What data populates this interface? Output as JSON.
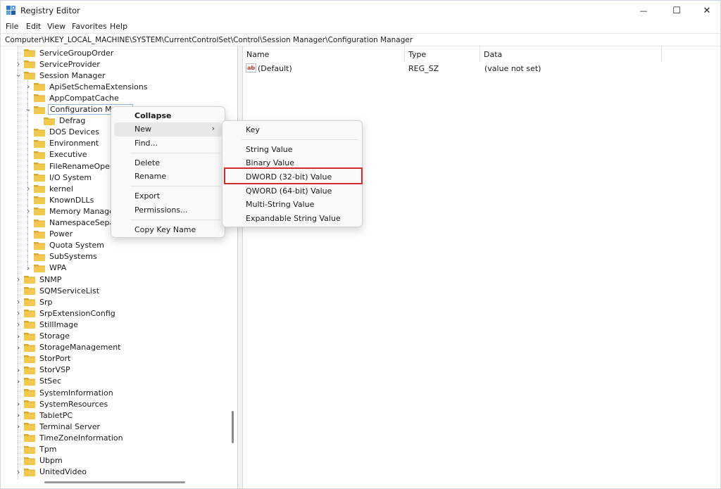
{
  "window": {
    "title": "Registry Editor",
    "controls": {
      "minimize": "—",
      "maximize": "☐",
      "close": "✕"
    }
  },
  "menubar": [
    "File",
    "Edit",
    "View",
    "Favorites",
    "Help"
  ],
  "address": "Computer\\HKEY_LOCAL_MACHINE\\SYSTEM\\CurrentControlSet\\Control\\Session Manager\\Configuration Manager",
  "tree": [
    {
      "label": "ServiceGroupOrder",
      "level": 0,
      "expander": "none"
    },
    {
      "label": "ServiceProvider",
      "level": 0,
      "expander": "collapsed"
    },
    {
      "label": "Session Manager",
      "level": 0,
      "expander": "expanded"
    },
    {
      "label": "ApiSetSchemaExtensions",
      "level": 1,
      "expander": "collapsed"
    },
    {
      "label": "AppCompatCache",
      "level": 1,
      "expander": "none"
    },
    {
      "label": "Configuration Manag",
      "level": 1,
      "expander": "expanded",
      "selected": true
    },
    {
      "label": "Defrag",
      "level": 2,
      "expander": "none"
    },
    {
      "label": "DOS Devices",
      "level": 1,
      "expander": "none"
    },
    {
      "label": "Environment",
      "level": 1,
      "expander": "none"
    },
    {
      "label": "Executive",
      "level": 1,
      "expander": "none"
    },
    {
      "label": "FileRenameOperatio",
      "level": 1,
      "expander": "none"
    },
    {
      "label": "I/O System",
      "level": 1,
      "expander": "none"
    },
    {
      "label": "kernel",
      "level": 1,
      "expander": "collapsed"
    },
    {
      "label": "KnownDLLs",
      "level": 1,
      "expander": "none"
    },
    {
      "label": "Memory Managem",
      "level": 1,
      "expander": "collapsed"
    },
    {
      "label": "NamespaceSeparat",
      "level": 1,
      "expander": "none"
    },
    {
      "label": "Power",
      "level": 1,
      "expander": "none"
    },
    {
      "label": "Quota System",
      "level": 1,
      "expander": "none"
    },
    {
      "label": "SubSystems",
      "level": 1,
      "expander": "none"
    },
    {
      "label": "WPA",
      "level": 1,
      "expander": "collapsed"
    },
    {
      "label": "SNMP",
      "level": 0,
      "expander": "collapsed"
    },
    {
      "label": "SQMServiceList",
      "level": 0,
      "expander": "none"
    },
    {
      "label": "Srp",
      "level": 0,
      "expander": "collapsed"
    },
    {
      "label": "SrpExtensionConfig",
      "level": 0,
      "expander": "collapsed"
    },
    {
      "label": "StillImage",
      "level": 0,
      "expander": "collapsed"
    },
    {
      "label": "Storage",
      "level": 0,
      "expander": "collapsed"
    },
    {
      "label": "StorageManagement",
      "level": 0,
      "expander": "collapsed"
    },
    {
      "label": "StorPort",
      "level": 0,
      "expander": "none"
    },
    {
      "label": "StorVSP",
      "level": 0,
      "expander": "collapsed"
    },
    {
      "label": "StSec",
      "level": 0,
      "expander": "collapsed"
    },
    {
      "label": "SystemInformation",
      "level": 0,
      "expander": "none"
    },
    {
      "label": "SystemResources",
      "level": 0,
      "expander": "collapsed"
    },
    {
      "label": "TabletPC",
      "level": 0,
      "expander": "collapsed"
    },
    {
      "label": "Terminal Server",
      "level": 0,
      "expander": "collapsed"
    },
    {
      "label": "TimeZoneInformation",
      "level": 0,
      "expander": "none"
    },
    {
      "label": "Tpm",
      "level": 0,
      "expander": "none"
    },
    {
      "label": "Ubpm",
      "level": 0,
      "expander": "none"
    },
    {
      "label": "UnitedVideo",
      "level": 0,
      "expander": "collapsed"
    }
  ],
  "list": {
    "columns": [
      "Name",
      "Type",
      "Data"
    ],
    "rows": [
      {
        "name": "(Default)",
        "type": "REG_SZ",
        "data": "(value not set)",
        "icon": "string-value-icon",
        "icon_glyph": "ab"
      }
    ]
  },
  "context_menu": {
    "collapse": "Collapse",
    "new": "New",
    "find": "Find...",
    "delete": "Delete",
    "rename": "Rename",
    "export": "Export",
    "permissions": "Permissions...",
    "copy_key_name": "Copy Key Name",
    "submenu_arrow": "›"
  },
  "new_submenu": {
    "key": "Key",
    "string_value": "String Value",
    "binary_value": "Binary Value",
    "dword_value": "DWORD (32-bit) Value",
    "qword_value": "QWORD (64-bit) Value",
    "multi_string_value": "Multi-String Value",
    "expandable_string_value": "Expandable String Value"
  },
  "colors": {
    "folder": "#f2c94c",
    "folder_dark": "#d9a92a",
    "highlight_border": "#d62a2a",
    "selection_border": "#8fb6e0"
  }
}
